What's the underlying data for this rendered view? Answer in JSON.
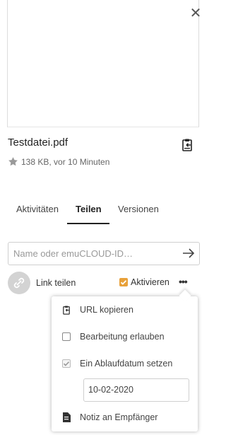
{
  "file": {
    "name": "Testdatei.pdf",
    "meta": "138 KB, vor 10 Minuten"
  },
  "icons": {
    "close": "close-icon",
    "clipboard": "clipboard-icon",
    "star": "star-icon",
    "arrow": "arrow-right-icon",
    "link": "link-icon",
    "more": "more-dots-icon",
    "note": "note-icon"
  },
  "tabs": [
    {
      "label": "Aktivitäten"
    },
    {
      "label": "Teilen",
      "active": true
    },
    {
      "label": "Versionen"
    }
  ],
  "share": {
    "placeholder": "Name oder emuCLOUD-ID…"
  },
  "link_share": {
    "label": "Link teilen",
    "activate_label": "Aktivieren",
    "activate_checked": true
  },
  "menu": {
    "copy_url": "URL kopieren",
    "allow_edit": "Bearbeitung erlauben",
    "allow_edit_checked": false,
    "set_expiry": "Ein Ablaufdatum setzen",
    "set_expiry_checked": true,
    "expiry_date": "10-02-2020",
    "note": "Notiz an Empfänger"
  },
  "colors": {
    "accent": "#e8a13a",
    "link_circle": "#d3d3d3",
    "text": "#222222"
  }
}
